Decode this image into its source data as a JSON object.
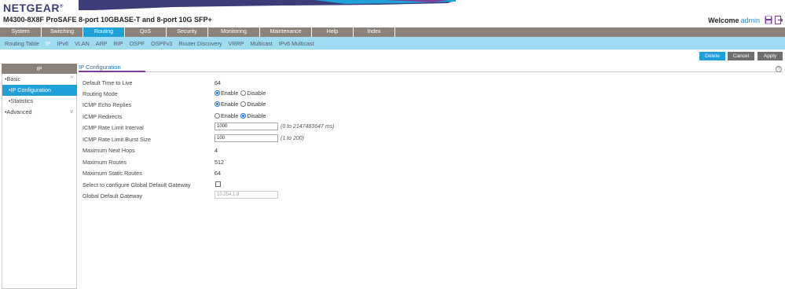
{
  "header": {
    "logo": "NETGEAR",
    "logo_mark": "®",
    "model": "M4300-8X8F ProSAFE 8-port 10GBASE-T and 8-port 10G SFP+",
    "welcome_label": "Welcome",
    "user": "admin",
    "brand_color": "#3c3c78"
  },
  "main_nav": {
    "tabs": [
      {
        "label": "System"
      },
      {
        "label": "Switching"
      },
      {
        "label": "Routing",
        "active": true
      },
      {
        "label": "QoS"
      },
      {
        "label": "Security"
      },
      {
        "label": "Monitoring"
      },
      {
        "label": "Maintenance"
      },
      {
        "label": "Help"
      },
      {
        "label": "Index"
      }
    ],
    "bg_color": "#8c8178",
    "active_color": "#1ea0d8"
  },
  "sub_nav": {
    "items": [
      {
        "label": "Routing Table"
      },
      {
        "label": "IP",
        "active": true
      },
      {
        "label": "IPv6"
      },
      {
        "label": "VLAN"
      },
      {
        "label": "ARP"
      },
      {
        "label": "RIP"
      },
      {
        "label": "OSPF"
      },
      {
        "label": "OSPFv3"
      },
      {
        "label": "Router Discovery"
      },
      {
        "label": "VRRP"
      },
      {
        "label": "Multicast"
      },
      {
        "label": "IPv6 Multicast"
      }
    ],
    "bg_color": "#9fdcf1"
  },
  "actions": {
    "delete": "Delete",
    "cancel": "Cancel",
    "apply": "Apply"
  },
  "sidebar": {
    "title": "IP",
    "items": [
      {
        "label": "Basic",
        "bullet": "•",
        "chevron": "^"
      },
      {
        "label": "IP Configuration",
        "bullet": "•",
        "active": true
      },
      {
        "label": "Statistics",
        "bullet": "•"
      },
      {
        "label": "Advanced",
        "bullet": "•",
        "chevron": "v"
      }
    ]
  },
  "content": {
    "section_title": "IP Configuration",
    "help": "?",
    "fields": {
      "ttl": {
        "label": "Default Time to Live",
        "value": "64"
      },
      "routing_mode": {
        "label": "Routing Mode",
        "enable": "Enable",
        "disable": "Disable",
        "selected": "Enable"
      },
      "icmp_echo": {
        "label": "ICMP Echo Replies",
        "enable": "Enable",
        "disable": "Disable",
        "selected": "Enable"
      },
      "icmp_redirects": {
        "label": "ICMP Redirects",
        "enable": "Enable",
        "disable": "Disable",
        "selected": "Disable"
      },
      "rate_interval": {
        "label": "ICMP Rate Limit Interval",
        "value": "1000",
        "hint": "(0 to 2147483647 ms)"
      },
      "burst_size": {
        "label": "ICMP Rate Limit Burst Size",
        "value": "100",
        "hint": "(1 to 200)"
      },
      "next_hops": {
        "label": "Maximum Next Hops",
        "value": "4"
      },
      "max_routes": {
        "label": "Maximum Routes",
        "value": "512"
      },
      "max_static": {
        "label": "Maximum Static Routes",
        "value": "64"
      },
      "gw_select": {
        "label": "Select to configure Global Default Gateway",
        "checked": false
      },
      "gw": {
        "label": "Global Default Gateway",
        "value": "10.254.1.9"
      }
    }
  }
}
